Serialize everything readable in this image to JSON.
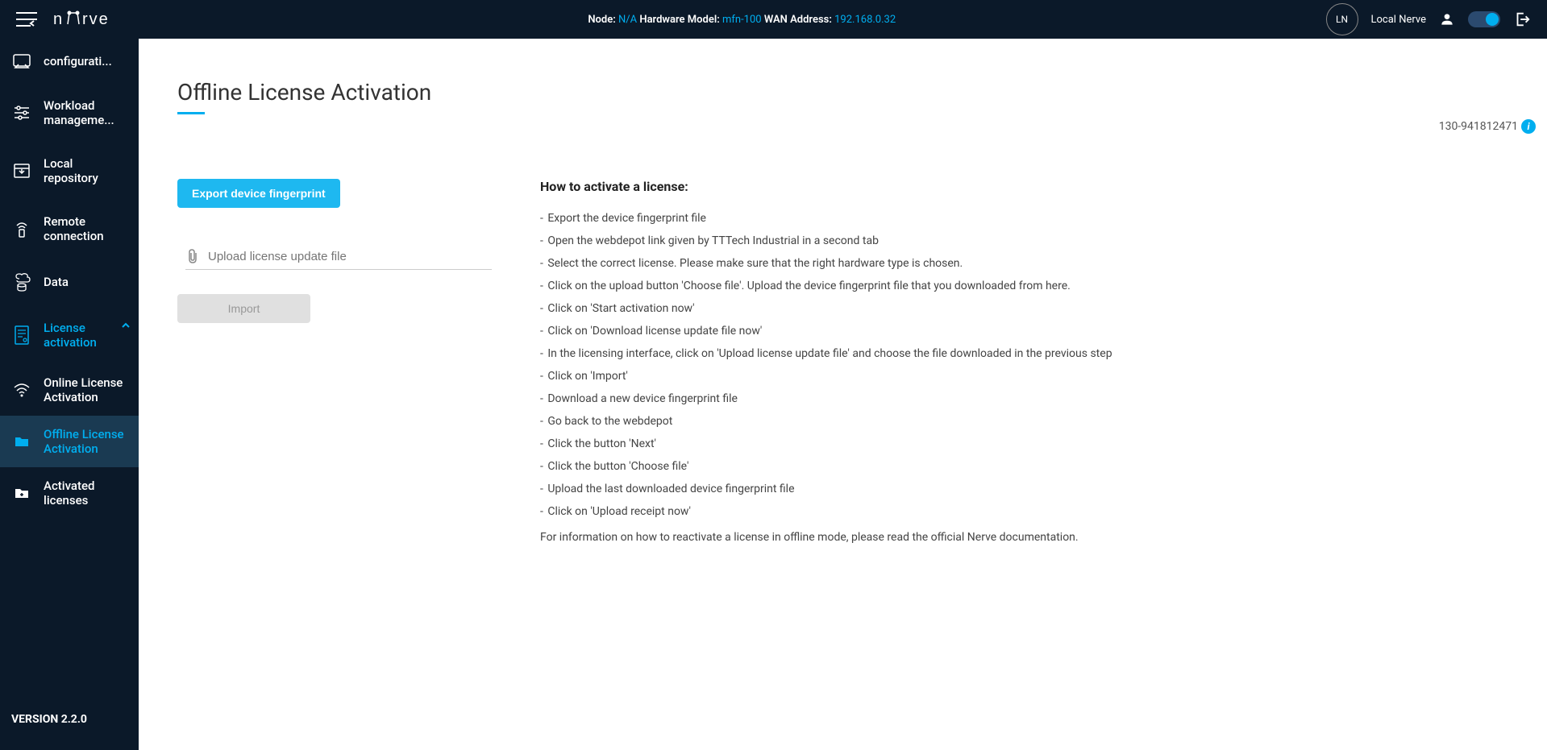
{
  "header": {
    "node_label": "Node: ",
    "node_value": "N/A",
    "hw_label": " Hardware Model: ",
    "hw_value": "mfn-100",
    "wan_label": " WAN Address: ",
    "wan_value": "192.168.0.32",
    "avatar_initials": "LN",
    "tenant_name": "Local Nerve"
  },
  "sidebar": {
    "items": [
      {
        "label": "configurati..."
      },
      {
        "label": "Workload manageme..."
      },
      {
        "label": "Local repository"
      },
      {
        "label": "Remote connection"
      },
      {
        "label": "Data"
      },
      {
        "label": "License activation"
      },
      {
        "label": "Online License Activation"
      },
      {
        "label": "Offline License Activation"
      },
      {
        "label": "Activated licenses"
      }
    ],
    "version": "VERSION 2.2.0"
  },
  "page": {
    "title": "Offline License Activation",
    "serial": "130-941812471",
    "export_btn": "Export device fingerprint",
    "upload_placeholder": "Upload license update file",
    "import_btn": "Import",
    "instructions_title": "How to activate a license:",
    "steps": [
      "Export the device fingerprint file",
      "Open the webdepot link given by TTTech Industrial in a second tab",
      "Select the correct license. Please make sure that the right hardware type is chosen.",
      "Click on the upload button 'Choose file'. Upload the device fingerprint file that you downloaded from here.",
      "Click on 'Start activation now'",
      "Click on 'Download license update file now'",
      "In the licensing interface, click on 'Upload license update file' and choose the file downloaded in the previous step",
      "Click on 'Import'",
      "Download a new device fingerprint file",
      "Go back to the webdepot",
      "Click the button 'Next'",
      "Click the button 'Choose file'",
      "Upload the last downloaded device fingerprint file",
      "Click on 'Upload receipt now'"
    ],
    "footer_note": "For information on how to reactivate a license in offline mode, please read the official Nerve documentation."
  }
}
